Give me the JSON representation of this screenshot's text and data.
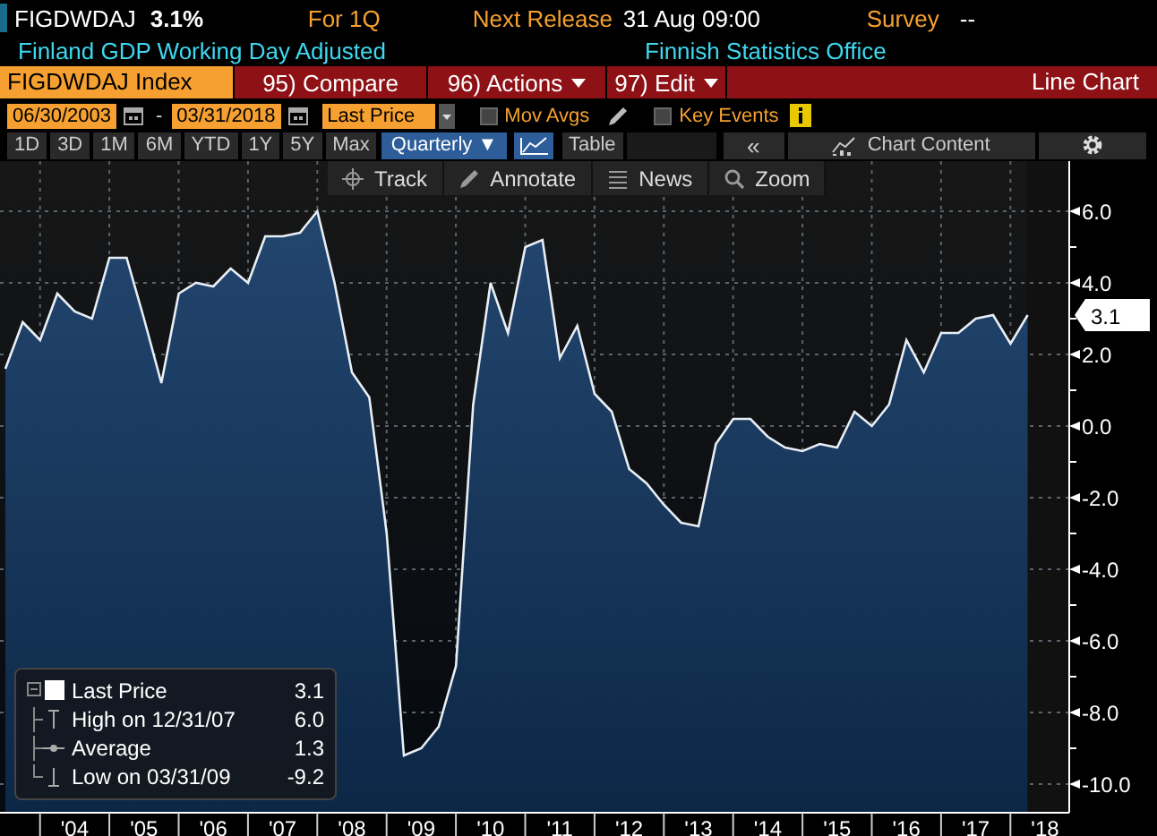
{
  "header": {
    "ticker": "FIGDWDAJ",
    "change": "3.1%",
    "period": "For 1Q",
    "release_label": "Next Release",
    "release_time": "31 Aug 09:00",
    "survey_label": "Survey",
    "survey_value": "--",
    "description": "Finland GDP Working Day Adjusted",
    "source": "Finnish Statistics Office"
  },
  "command_bar": {
    "security": "FIGDWDAJ Index",
    "actions": [
      {
        "label": "95) Compare",
        "dropdown": false
      },
      {
        "label": "96) Actions",
        "dropdown": true
      },
      {
        "label": "97) Edit",
        "dropdown": true
      }
    ],
    "chart_type": "Line Chart"
  },
  "settings": {
    "start_date": "06/30/2003",
    "separator": "-",
    "end_date": "03/31/2018",
    "field": "Last Price",
    "options": [
      {
        "label": "Mov Avgs",
        "checked": false
      },
      {
        "label": "Key Events",
        "checked": false
      }
    ]
  },
  "ranges": [
    {
      "label": "1D",
      "selected": false
    },
    {
      "label": "3D",
      "selected": false
    },
    {
      "label": "1M",
      "selected": false
    },
    {
      "label": "6M",
      "selected": false
    },
    {
      "label": "YTD",
      "selected": false
    },
    {
      "label": "1Y",
      "selected": false
    },
    {
      "label": "5Y",
      "selected": false
    },
    {
      "label": "Max",
      "selected": false
    },
    {
      "label": "Quarterly ▼",
      "selected": true
    }
  ],
  "view_buttons": {
    "table": "Table",
    "collapse": "«",
    "chart_content": "Chart Content"
  },
  "chart_tools": [
    "Track",
    "Annotate",
    "News",
    "Zoom"
  ],
  "legend": [
    {
      "kind": "last",
      "value": "3.1"
    },
    {
      "kind": "high",
      "label": "High on 12/31/07",
      "value": "6.0"
    },
    {
      "kind": "average",
      "label": "Average",
      "value": "1.3"
    },
    {
      "kind": "low",
      "label": "Low on 03/31/09",
      "value": "-9.2"
    }
  ],
  "chart": {
    "last_value_label": "3.1",
    "chart_data": {
      "type": "area",
      "grid": true,
      "ylim": [
        -10.8,
        7.4
      ],
      "categories": [
        null,
        null,
        null,
        null,
        "'04",
        null,
        null,
        null,
        "'05",
        null,
        null,
        null,
        "'06",
        null,
        null,
        null,
        "'07",
        null,
        null,
        null,
        "'08",
        null,
        null,
        null,
        "'09",
        null,
        null,
        null,
        "'10",
        null,
        null,
        null,
        "'11",
        null,
        null,
        null,
        "'12",
        null,
        null,
        null,
        "'13",
        null,
        null,
        null,
        "'14",
        null,
        null,
        null,
        "'15",
        null,
        null,
        null,
        "'16",
        null,
        null,
        null,
        "'17",
        null,
        null,
        null,
        "'18"
      ],
      "series": [
        {
          "name": "Last Price",
          "color": "#e8eef5",
          "values": [
            1.6,
            2.9,
            2.4,
            3.7,
            3.2,
            3.0,
            4.7,
            4.7,
            3.0,
            1.2,
            3.7,
            4.0,
            3.9,
            4.4,
            4.0,
            5.3,
            5.3,
            5.4,
            6.0,
            4.0,
            1.5,
            0.8,
            -3.0,
            -9.2,
            -9.0,
            -8.4,
            -6.7,
            0.6,
            4.0,
            2.6,
            5.0,
            5.2,
            1.9,
            2.8,
            0.9,
            0.4,
            -1.2,
            -1.6,
            -2.2,
            -2.7,
            -2.8,
            -0.5,
            0.2,
            0.2,
            -0.3,
            -0.6,
            -0.7,
            -0.5,
            -0.6,
            0.4,
            0.0,
            0.6,
            2.4,
            1.5,
            2.6,
            2.6,
            3.0,
            3.1,
            2.3,
            3.1,
            null
          ]
        }
      ],
      "yticks": [
        {
          "value": 6,
          "label": "6.0"
        },
        {
          "value": 4,
          "label": "4.0"
        },
        {
          "value": 2,
          "label": "2.0"
        },
        {
          "value": 0,
          "label": "0.0"
        },
        {
          "value": -2,
          "label": "-2.0"
        },
        {
          "value": -4,
          "label": "-4.0"
        },
        {
          "value": -6,
          "label": "-6.0"
        },
        {
          "value": -8,
          "label": "-8.0"
        },
        {
          "value": -10,
          "label": "-10.0"
        }
      ]
    }
  }
}
